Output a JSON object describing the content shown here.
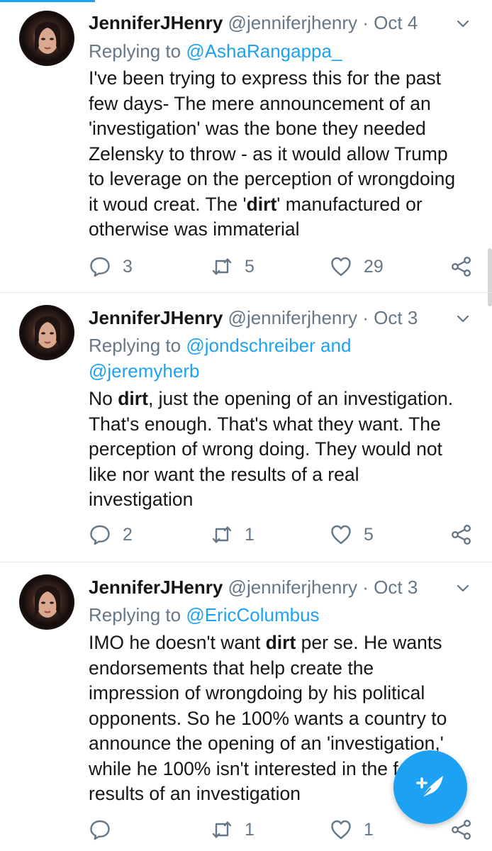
{
  "tweets": [
    {
      "name": "JenniferJHenry",
      "handle": "@jenniferjhenry",
      "date": "Oct 4",
      "replying_prefix": "Replying to",
      "replying_links": [
        "@AshaRangappa_"
      ],
      "body_lines": [
        [
          {
            "t": "I've been trying to express this for the past"
          }
        ],
        [
          {
            "t": "few days- The mere announcement of an"
          }
        ],
        [
          {
            "t": "'investigation' was the bone they needed"
          }
        ],
        [
          {
            "t": "Zelensky to throw - as it would allow Trump"
          }
        ],
        [
          {
            "t": "to leverage on the perception of wrongdoing"
          }
        ],
        [
          {
            "t": "it woud creat. The '"
          },
          {
            "t": "dirt",
            "b": true
          },
          {
            "t": "' manufactured or"
          }
        ],
        [
          {
            "t": "otherwise was immaterial"
          }
        ]
      ],
      "replies": "3",
      "retweets": "5",
      "likes": "29"
    },
    {
      "name": "JenniferJHenry",
      "handle": "@jenniferjhenry",
      "date": "Oct 3",
      "replying_prefix": "Replying to",
      "replying_links": [
        "@jondschreiber and",
        "@jeremyherb"
      ],
      "body_lines": [
        [
          {
            "t": "No "
          },
          {
            "t": "dirt",
            "b": true
          },
          {
            "t": ", just the opening of an investigation."
          }
        ],
        [
          {
            "t": "That's enough. That's what they want. The"
          }
        ],
        [
          {
            "t": "perception of wrong doing. They would not"
          }
        ],
        [
          {
            "t": "like nor want the results of a real"
          }
        ],
        [
          {
            "t": "investigation"
          }
        ]
      ],
      "replies": "2",
      "retweets": "1",
      "likes": "5"
    },
    {
      "name": "JenniferJHenry",
      "handle": "@jenniferjhenry",
      "date": "Oct 3",
      "replying_prefix": "Replying to",
      "replying_links": [
        "@EricColumbus"
      ],
      "body_lines": [
        [
          {
            "t": "IMO he doesn't want "
          },
          {
            "t": "dirt",
            "b": true
          },
          {
            "t": " per se. He wants"
          }
        ],
        [
          {
            "t": "endorsements that help create the"
          }
        ],
        [
          {
            "t": "impression of wrongdoing by his political"
          }
        ],
        [
          {
            "t": "opponents. So he 100% wants a country to"
          }
        ],
        [
          {
            "t": "announce the opening of an 'investigation,'"
          }
        ],
        [
          {
            "t": "while he 100% isn't interested in the f"
          }
        ],
        [
          {
            "t": "results of an investigation"
          }
        ]
      ],
      "replies": "",
      "retweets": "1",
      "likes": "1"
    }
  ],
  "icons": {
    "reply": "reply-icon",
    "retweet": "retweet-icon",
    "like": "heart-icon",
    "share": "share-icon",
    "menu": "chevron-down-icon",
    "compose": "compose-tweet-icon"
  },
  "colors": {
    "accent": "#1da1f2",
    "secondary_text": "#657786",
    "divider": "#e1e8ed"
  }
}
